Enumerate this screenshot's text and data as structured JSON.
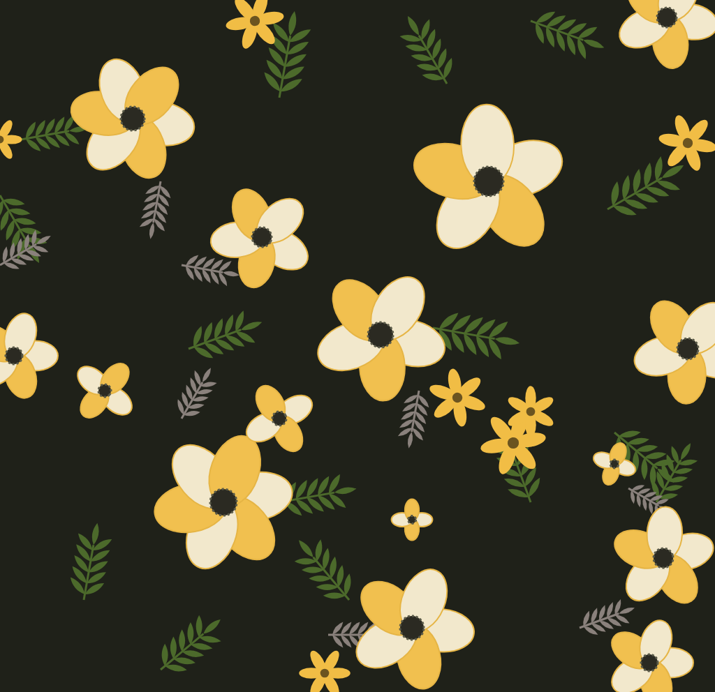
{
  "artwork": {
    "kind": "floral-pattern"
  }
}
